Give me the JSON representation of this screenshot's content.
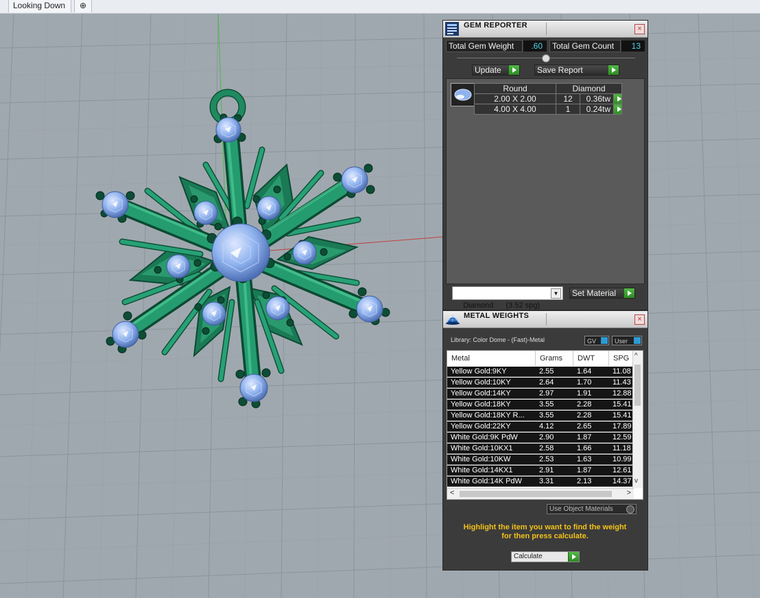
{
  "viewport": {
    "tab_label": "Looking Down",
    "add_tab_symbol": "⊕"
  },
  "gem_reporter": {
    "title": "GEM REPORTER",
    "close_symbol": "×",
    "total_gem_weight_label": "Total Gem Weight",
    "total_gem_weight_value": ".60",
    "total_gem_count_label": "Total Gem Count",
    "total_gem_count_value": "13",
    "update_label": "Update",
    "save_report_label": "Save Report",
    "table": {
      "shape": "Round",
      "material": "Diamond",
      "rows": [
        {
          "size": "2.00 X 2.00",
          "count": "12",
          "weight": "0.36tw"
        },
        {
          "size": "4.00 X 4.00",
          "count": "1",
          "weight": "0.24tw"
        }
      ]
    },
    "material_select": "Diamond      (3.52 spg)",
    "set_material_label": "Set Material"
  },
  "metal_weights": {
    "title": "METAL WEIGHTS",
    "close_symbol": "×",
    "library_label": "Library: Color Dome - (Fast)-Metal",
    "gv_label": "GV",
    "user_label": "User",
    "columns": [
      "Metal",
      "Grams",
      "DWT",
      "SPG"
    ],
    "rows": [
      {
        "metal": "Yellow Gold:9KY",
        "grams": "2.55",
        "dwt": "1.64",
        "spg": "11.08"
      },
      {
        "metal": "Yellow Gold:10KY",
        "grams": "2.64",
        "dwt": "1.70",
        "spg": "11.43"
      },
      {
        "metal": "Yellow Gold:14KY",
        "grams": "2.97",
        "dwt": "1.91",
        "spg": "12.88"
      },
      {
        "metal": "Yellow Gold:18KY",
        "grams": "3.55",
        "dwt": "2.28",
        "spg": "15.41"
      },
      {
        "metal": "Yellow Gold:18KY R...",
        "grams": "3.55",
        "dwt": "2.28",
        "spg": "15.41"
      },
      {
        "metal": "Yellow Gold:22KY",
        "grams": "4.12",
        "dwt": "2.65",
        "spg": "17.89"
      },
      {
        "metal": "White Gold:9K PdW",
        "grams": "2.90",
        "dwt": "1.87",
        "spg": "12.59"
      },
      {
        "metal": "White Gold:10KX1",
        "grams": "2.58",
        "dwt": "1.66",
        "spg": "11.18"
      },
      {
        "metal": "White Gold:10KW",
        "grams": "2.53",
        "dwt": "1.63",
        "spg": "10.99"
      },
      {
        "metal": "White Gold:14KX1",
        "grams": "2.91",
        "dwt": "1.87",
        "spg": "12.61"
      },
      {
        "metal": "White Gold:14K PdW",
        "grams": "3.31",
        "dwt": "2.13",
        "spg": "14.37"
      }
    ],
    "use_object_materials_label": "Use Object Materials",
    "hint_line1": "Highlight the item you want to find the weight",
    "hint_line2": "for then press calculate.",
    "calculate_label": "Calculate"
  },
  "colors": {
    "metal_green": "#1f8a60",
    "gem_blue": "#8fb2ee",
    "panel_bg": "#3b3b3b",
    "hint_yellow": "#f2c21a",
    "value_cyan": "#4fd6e8"
  }
}
